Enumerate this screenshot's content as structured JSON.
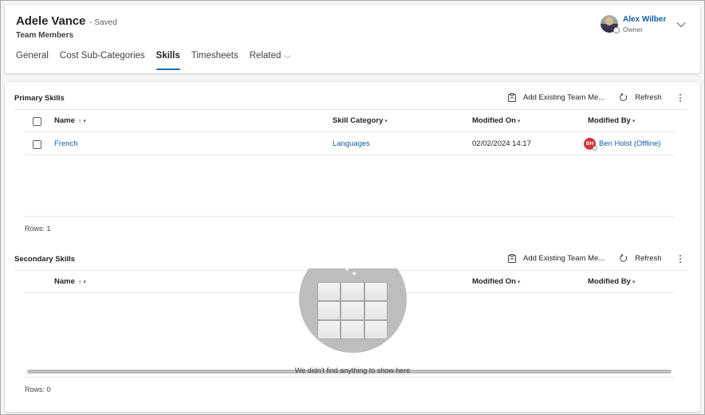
{
  "header": {
    "record_title": "Adele Vance",
    "saved_status": "- Saved",
    "entity_name": "Team Members",
    "tabs": [
      {
        "label": "General",
        "active": false
      },
      {
        "label": "Cost Sub-Categories",
        "active": false
      },
      {
        "label": "Skills",
        "active": true
      },
      {
        "label": "Timesheets",
        "active": false
      },
      {
        "label": "Related",
        "active": false,
        "has_dropdown": true
      }
    ],
    "owner": {
      "name": "Alex Wilber",
      "role": "Owner"
    }
  },
  "primary_skills": {
    "title": "Primary Skills",
    "commands": {
      "add_existing": "Add Existing Team Me...",
      "refresh": "Refresh"
    },
    "columns": [
      {
        "label": "Name",
        "sort": "↑",
        "chevron": "⌄"
      },
      {
        "label": "Skill Category",
        "chevron": "⌄"
      },
      {
        "label": "Modified On",
        "chevron": "⌄"
      },
      {
        "label": "Modified By",
        "chevron": "⌄"
      }
    ],
    "rows": [
      {
        "name": "French",
        "skill_category": "Languages",
        "modified_on": "02/02/2024 14:17",
        "modified_by": "Ben Holst (Offline)",
        "modified_by_initials": "BH"
      }
    ],
    "rows_label": "Rows: 1"
  },
  "secondary_skills": {
    "title": "Secondary Skills",
    "commands": {
      "add_existing": "Add Existing Team Me...",
      "refresh": "Refresh"
    },
    "columns": [
      {
        "label": "Name",
        "sort": "↑",
        "chevron": "⌄"
      },
      {
        "label": "Modified On",
        "chevron": "⌄"
      },
      {
        "label": "Modified By",
        "chevron": "⌄"
      }
    ],
    "rows": [],
    "empty_message": "We didn't find anything to show here",
    "rows_label": "Rows: 0"
  },
  "colors": {
    "accent": "#0f6cbd",
    "link": "#115ea3",
    "avatar_red": "#d13438"
  }
}
